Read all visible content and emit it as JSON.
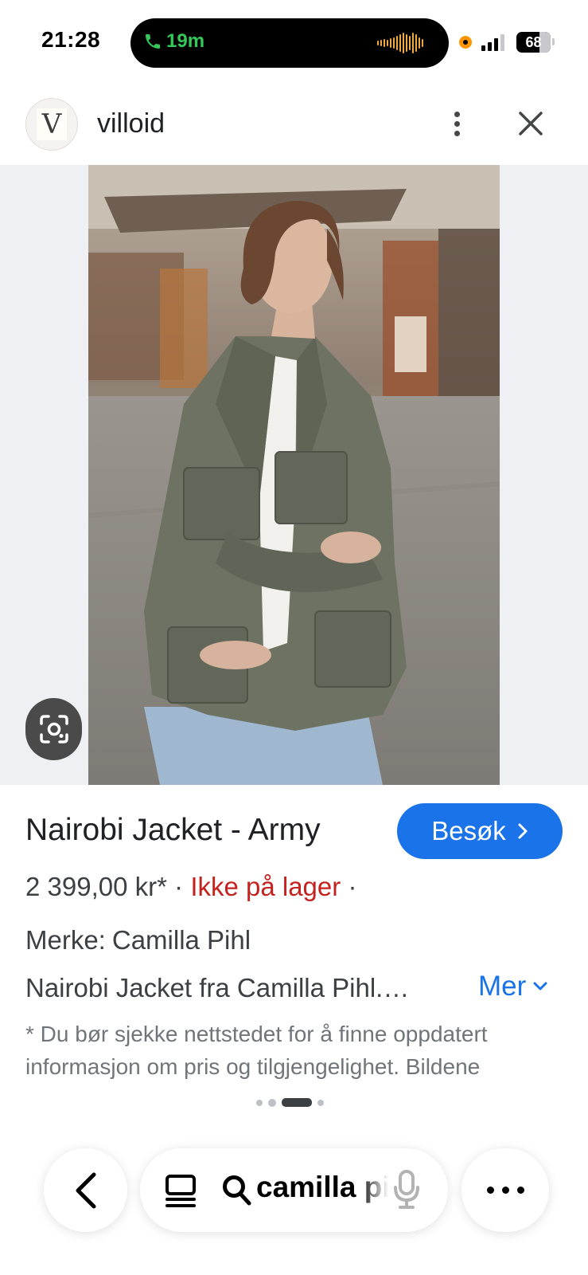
{
  "status_bar": {
    "time": "21:28",
    "call_duration": "19m",
    "battery_percent": "68",
    "battery_level": 0.68,
    "signal_bars_active": 3,
    "call_color": "#34c759",
    "recording_indicator_color": "#ff9500"
  },
  "header": {
    "logo_letter": "V",
    "site_name": "villoid",
    "more_icon": "more-vert-icon",
    "close_icon": "close-icon"
  },
  "product": {
    "title": "Nairobi Jacket - Army",
    "visit_label": "Besøk",
    "price": "2 399,00 kr*",
    "separator": "·",
    "stock_status": "Ikke på lager",
    "brand_label": "Merke:",
    "brand": "Camilla Pihl",
    "description": "Nairobi Jacket fra Camilla Pihl.…",
    "more_label": "Mer",
    "disclaimer": "* Du bør sjekke nettstedet for å finne oppdatert informasjon om pris og tilgjengelighet. Bildene",
    "stock_color": "#c5221f",
    "accent_color": "#1a73e8"
  },
  "pager": {
    "total": 4,
    "active_index": 2
  },
  "bottom_bar": {
    "search_query": "camilla pihl",
    "back_icon": "chevron-left-icon",
    "tabs_icon": "tabs-icon",
    "search_icon": "search-icon",
    "mic_icon": "mic-icon",
    "overflow_icon": "more-horiz-icon"
  }
}
